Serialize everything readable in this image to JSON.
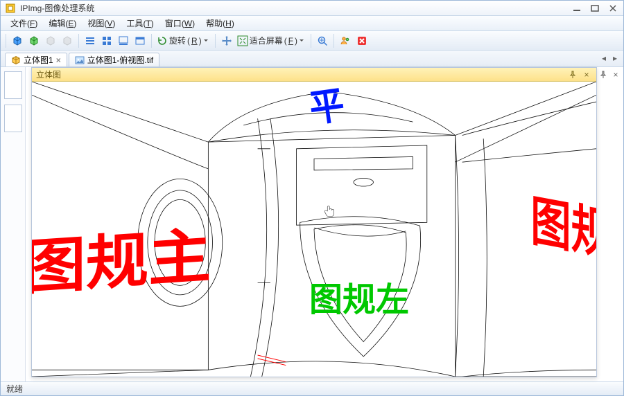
{
  "window": {
    "title": "IPImg-图像处理系统",
    "buttons": {
      "min": "min",
      "max": "max",
      "close": "close"
    }
  },
  "menu": {
    "items": [
      {
        "label": "文件",
        "accel": "F"
      },
      {
        "label": "编辑",
        "accel": "E"
      },
      {
        "label": "视图",
        "accel": "V"
      },
      {
        "label": "工具",
        "accel": "T"
      },
      {
        "label": "窗口",
        "accel": "W"
      },
      {
        "label": "帮助",
        "accel": "H"
      }
    ]
  },
  "toolbar": {
    "rotate_label": "旋转",
    "fit_label": "适合屏幕",
    "rotate_accel": "R",
    "fit_accel": "F"
  },
  "tabs": [
    {
      "label": "立体图1",
      "icon": "cube-icon",
      "active": true
    },
    {
      "label": "立体图1-俯视图.tif",
      "icon": "image-icon",
      "active": false
    }
  ],
  "float_panel": {
    "title": "立体图"
  },
  "overlays": {
    "left_red": "图规主",
    "top_blue": "平",
    "center_green": "图规左",
    "right_red": "图规右"
  },
  "status": {
    "text": "就绪"
  },
  "colors": {
    "frame": "#9db8d8",
    "panel_title_bg": "#fde18a",
    "red": "#ff0000",
    "blue": "#0018ff",
    "green": "#00c800"
  }
}
